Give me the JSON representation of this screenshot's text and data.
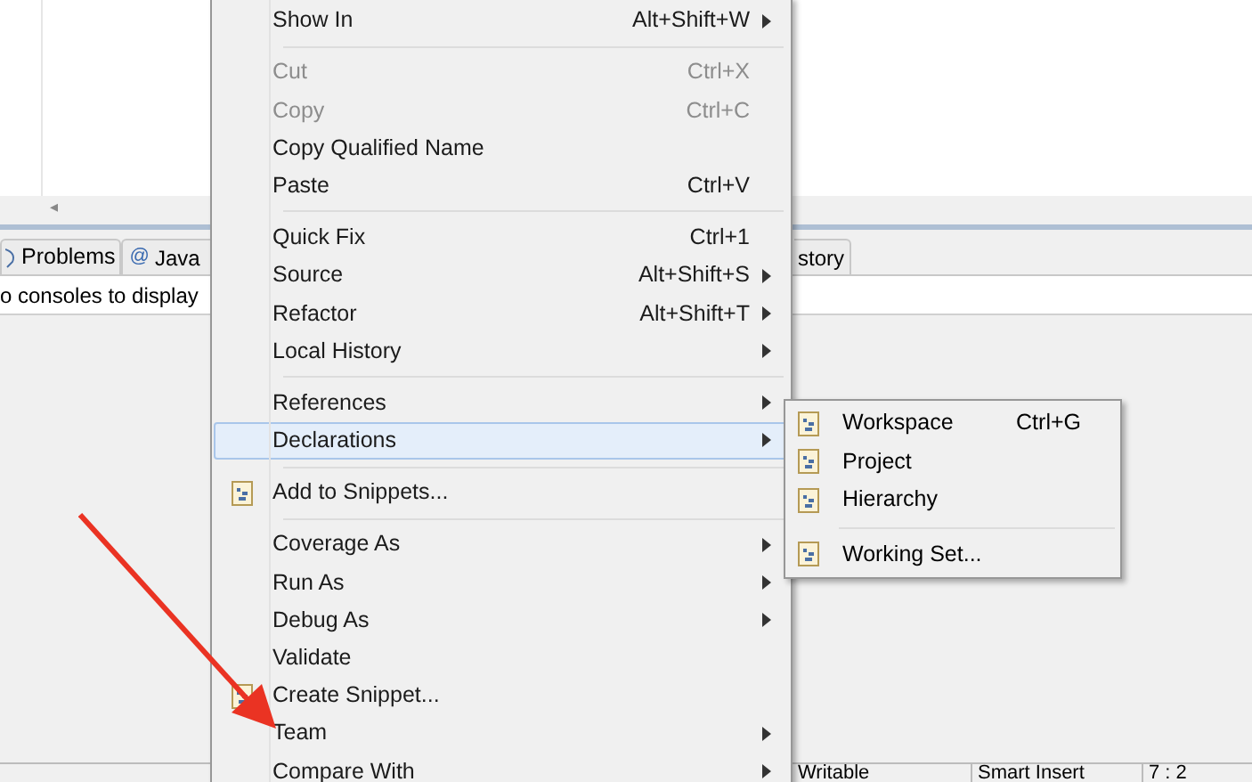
{
  "editor": {
    "scroll_arrow": "◂"
  },
  "bottom_panel": {
    "tabs": [
      {
        "label": "Problems",
        "selected": false
      },
      {
        "label": "Java",
        "icon_glyph": "@",
        "selected": false
      },
      {
        "label": "story",
        "selected": false
      }
    ],
    "console_message": "o consoles to display"
  },
  "status_bar": [
    "Writable",
    "Smart Insert",
    "7 : 2"
  ],
  "context_menu": {
    "items": [
      {
        "kind": "item",
        "label": "Show In",
        "shortcut": "Alt+Shift+W",
        "submenu": true,
        "disabled": false,
        "selected": false
      },
      {
        "kind": "separator"
      },
      {
        "kind": "item",
        "label": "Cut",
        "shortcut": "Ctrl+X",
        "submenu": false,
        "disabled": true,
        "selected": false
      },
      {
        "kind": "item",
        "label": "Copy",
        "shortcut": "Ctrl+C",
        "submenu": false,
        "disabled": true,
        "selected": false
      },
      {
        "kind": "item",
        "label": "Copy Qualified Name",
        "submenu": false,
        "disabled": false,
        "selected": false
      },
      {
        "kind": "item",
        "label": "Paste",
        "shortcut": "Ctrl+V",
        "submenu": false,
        "disabled": false,
        "selected": false
      },
      {
        "kind": "separator"
      },
      {
        "kind": "item",
        "label": "Quick Fix",
        "shortcut": "Ctrl+1",
        "submenu": false,
        "disabled": false,
        "selected": false
      },
      {
        "kind": "item",
        "label": "Source",
        "shortcut": "Alt+Shift+S",
        "submenu": true,
        "disabled": false,
        "selected": false
      },
      {
        "kind": "item",
        "label": "Refactor",
        "shortcut": "Alt+Shift+T",
        "submenu": true,
        "disabled": false,
        "selected": false
      },
      {
        "kind": "item",
        "label": "Local History",
        "submenu": true,
        "disabled": false,
        "selected": false
      },
      {
        "kind": "separator"
      },
      {
        "kind": "item",
        "label": "References",
        "submenu": true,
        "disabled": false,
        "selected": false
      },
      {
        "kind": "item",
        "label": "Declarations",
        "submenu": true,
        "disabled": false,
        "selected": true
      },
      {
        "kind": "separator"
      },
      {
        "kind": "icon_item",
        "label": "Add to Snippets...",
        "submenu": false,
        "disabled": false,
        "selected": false
      },
      {
        "kind": "separator"
      },
      {
        "kind": "item",
        "label": "Coverage As",
        "submenu": true,
        "disabled": false,
        "selected": false
      },
      {
        "kind": "item",
        "label": "Run As",
        "submenu": true,
        "disabled": false,
        "selected": false
      },
      {
        "kind": "item",
        "label": "Debug As",
        "submenu": true,
        "disabled": false,
        "selected": false
      },
      {
        "kind": "item",
        "label": "Validate",
        "submenu": false,
        "disabled": false,
        "selected": false
      },
      {
        "kind": "icon_item",
        "label": "Create Snippet...",
        "submenu": false,
        "disabled": false,
        "selected": false
      },
      {
        "kind": "item",
        "label": "Team",
        "submenu": true,
        "disabled": false,
        "selected": false
      },
      {
        "kind": "item",
        "label": "Compare With",
        "submenu": true,
        "disabled": false,
        "selected": false
      }
    ]
  },
  "submenu": {
    "items": [
      {
        "kind": "item",
        "label": "Workspace",
        "shortcut": "Ctrl+G"
      },
      {
        "kind": "item",
        "label": "Project"
      },
      {
        "kind": "item",
        "label": "Hierarchy"
      },
      {
        "kind": "separator"
      },
      {
        "kind": "item",
        "label": "Working Set..."
      }
    ]
  }
}
